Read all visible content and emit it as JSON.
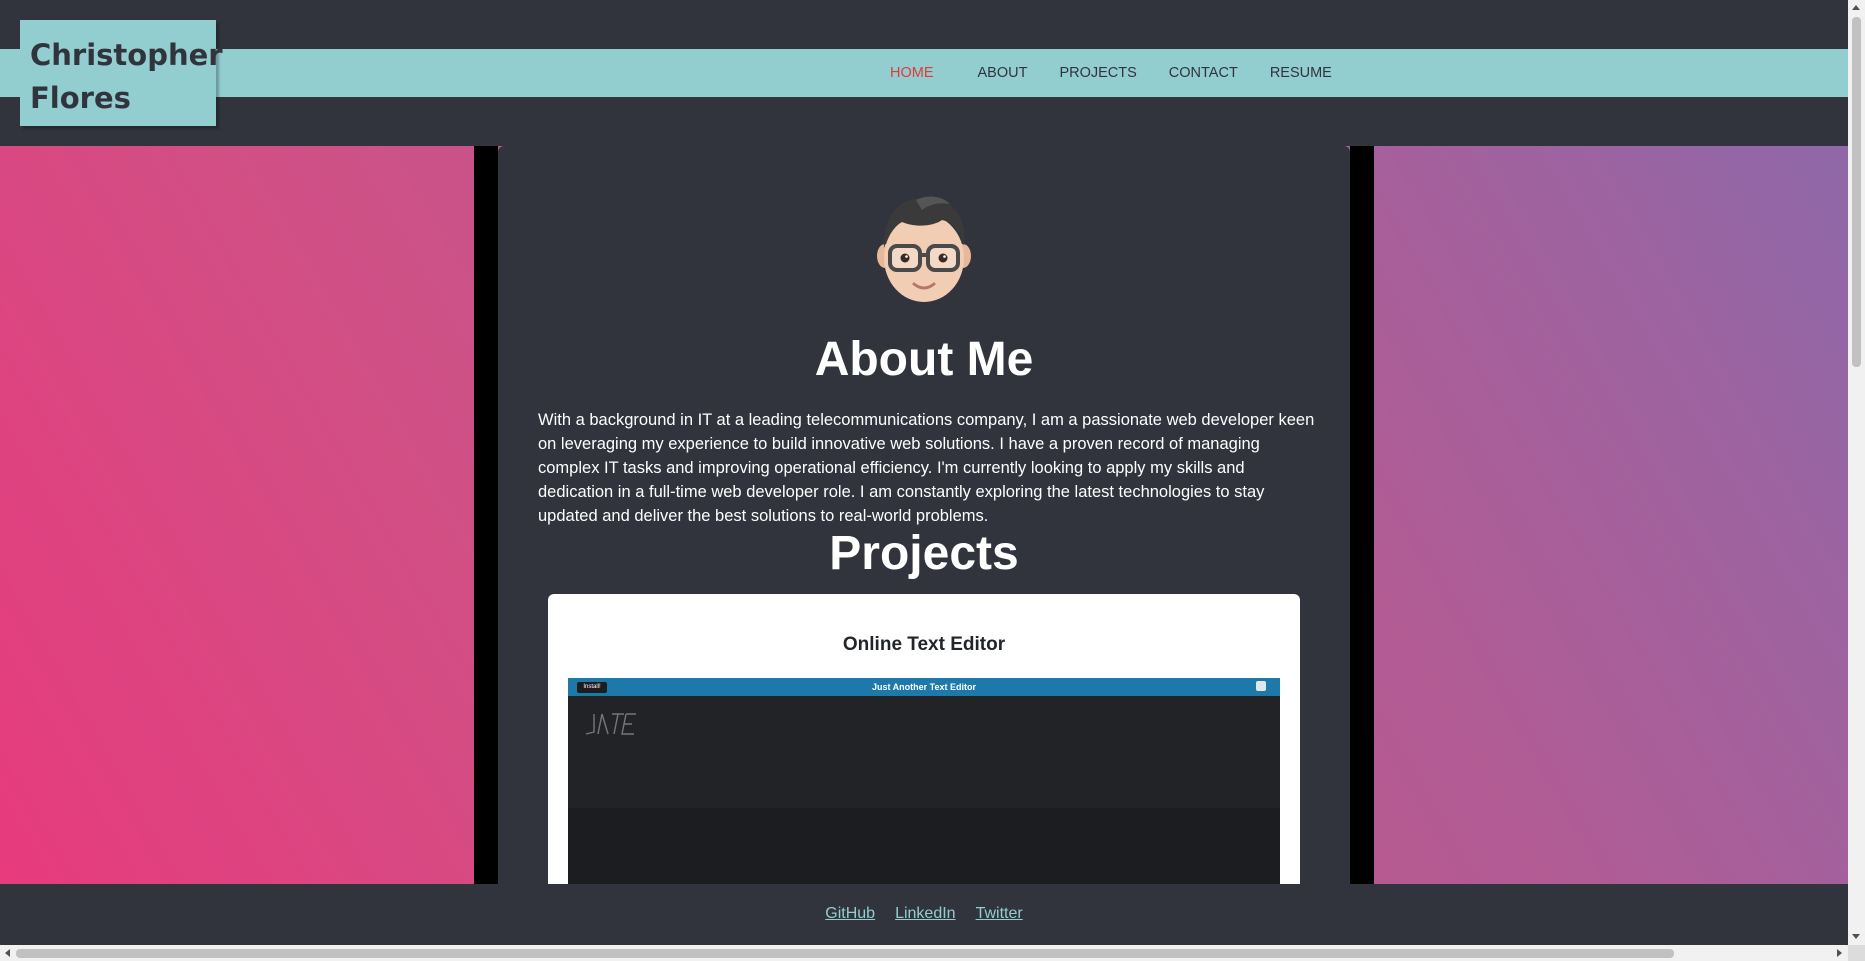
{
  "header": {
    "logo_line1": "Christopher",
    "logo_line2": "Flores",
    "nav": [
      {
        "label": "HOME",
        "active": true
      },
      {
        "label": "ABOUT",
        "active": false
      },
      {
        "label": "PROJECTS",
        "active": false
      },
      {
        "label": "CONTACT",
        "active": false
      },
      {
        "label": "RESUME",
        "active": false
      }
    ]
  },
  "about": {
    "title": "About Me",
    "text": "With a background in IT at a leading telecommunications company, I am a passionate web developer keen on leveraging my experience to build innovative web solutions. I have a proven record of managing complex IT tasks and improving operational efficiency. I'm currently looking to apply my skills and dedication in a full-time web developer role. I am constantly exploring the latest technologies to stay updated and deliver the best solutions to real-world problems."
  },
  "projects": {
    "title": "Projects",
    "card": {
      "title": "Online Text Editor",
      "screenshot_title": "Just Another Text Editor",
      "screenshot_button": "Install!"
    }
  },
  "footer": {
    "links": [
      "GitHub",
      "LinkedIn",
      "Twitter"
    ]
  },
  "colors": {
    "background": "#31343d",
    "accent": "#92cdcf",
    "active_nav": "#e23a3a",
    "gradient_start": "#e73b7d",
    "gradient_end": "#8f68a8"
  }
}
